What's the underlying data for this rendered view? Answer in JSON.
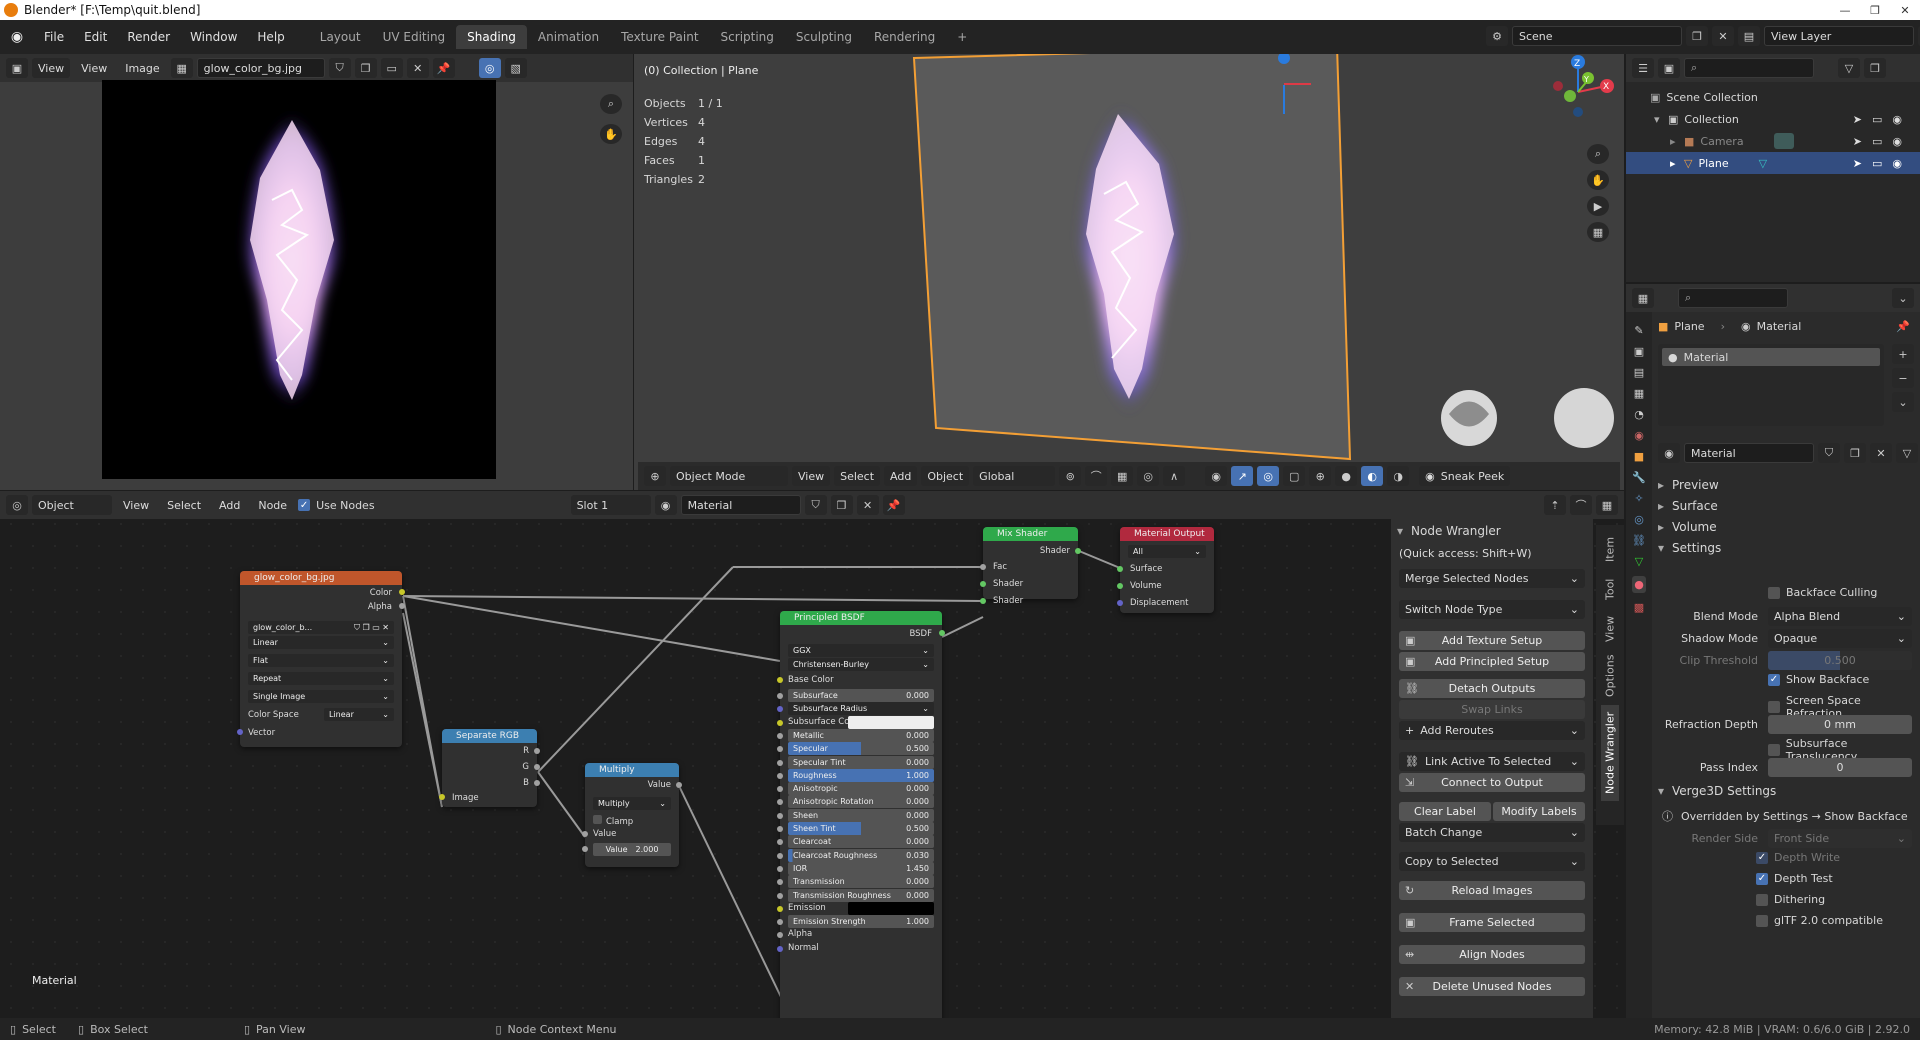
{
  "window": {
    "title": "Blender* [F:\\Temp\\quit.blend]",
    "controls": [
      "—",
      "❐",
      "✕"
    ]
  },
  "menu": [
    "File",
    "Edit",
    "Render",
    "Window",
    "Help"
  ],
  "workspaces": [
    {
      "label": "Layout",
      "active": false
    },
    {
      "label": "UV Editing",
      "active": false
    },
    {
      "label": "Shading",
      "active": true
    },
    {
      "label": "Animation",
      "active": false
    },
    {
      "label": "Texture Paint",
      "active": false
    },
    {
      "label": "Scripting",
      "active": false
    },
    {
      "label": "Sculpting",
      "active": false
    },
    {
      "label": "Rendering",
      "active": false
    }
  ],
  "workspace_add": "+",
  "scene": {
    "name": "Scene",
    "view_layer": "View Layer"
  },
  "image_editor": {
    "view_menu": "View",
    "menu": [
      "View",
      "Image"
    ],
    "image_name": "glow_color_bg.jpg"
  },
  "viewport": {
    "header_label": "(0) Collection | Plane",
    "stats": [
      {
        "k": "Objects",
        "v": "1 / 1"
      },
      {
        "k": "Vertices",
        "v": "4"
      },
      {
        "k": "Edges",
        "v": "4"
      },
      {
        "k": "Faces",
        "v": "1"
      },
      {
        "k": "Triangles",
        "v": "2"
      }
    ],
    "mode": "Object Mode",
    "menu": [
      "View",
      "Select",
      "Add",
      "Object"
    ],
    "transform": "Global",
    "sneak": "Sneak Peek",
    "gizmo": {
      "x": "X",
      "y": "Y",
      "z": "Z"
    }
  },
  "outliner": {
    "items": [
      {
        "label": "Scene Collection",
        "level": 0,
        "selected": false
      },
      {
        "label": "Collection",
        "level": 1,
        "selected": false
      },
      {
        "label": "Camera",
        "level": 2,
        "selected": false
      },
      {
        "label": "Plane",
        "level": 2,
        "selected": true
      }
    ]
  },
  "properties": {
    "breadcrumb": {
      "object": "Plane",
      "material": "Material"
    },
    "slot_name": "Material",
    "material_name": "Material",
    "panels": [
      {
        "label": "Preview",
        "open": false
      },
      {
        "label": "Surface",
        "open": false
      },
      {
        "label": "Volume",
        "open": false
      },
      {
        "label": "Settings",
        "open": true
      }
    ],
    "settings": {
      "backface_culling": {
        "label": "Backface Culling",
        "checked": false
      },
      "blend_mode": {
        "label": "Blend Mode",
        "value": "Alpha Blend"
      },
      "shadow_mode": {
        "label": "Shadow Mode",
        "value": "Opaque"
      },
      "clip_threshold": {
        "label": "Clip Threshold",
        "value": "0.500"
      },
      "show_backface": {
        "label": "Show Backface",
        "checked": true
      },
      "ssr": {
        "label": "Screen Space Refraction",
        "checked": false
      },
      "refraction_depth": {
        "label": "Refraction Depth",
        "value": "0 mm"
      },
      "sss_translucency": {
        "label": "Subsurface Translucency",
        "checked": false
      },
      "pass_index": {
        "label": "Pass Index",
        "value": "0"
      }
    },
    "verge": {
      "title": "Verge3D Settings",
      "note": "Overridden by Settings → Show Backface",
      "render_side": {
        "label": "Render Side",
        "value": "Front Side"
      },
      "depth_write": {
        "label": "Depth Write",
        "checked": true
      },
      "depth_test": {
        "label": "Depth Test",
        "checked": true
      },
      "dithering": {
        "label": "Dithering",
        "checked": false
      },
      "gltf": {
        "label": "glTF 2.0 compatible",
        "checked": false
      }
    }
  },
  "node_editor": {
    "object_mode": "Object",
    "menu": [
      "View",
      "Select",
      "Add",
      "Node"
    ],
    "use_nodes": "Use Nodes",
    "slot": "Slot 1",
    "material": "Material",
    "material_label": "Material",
    "sidebar_tabs": [
      "Item",
      "Tool",
      "View",
      "Options",
      "Node Wrangler"
    ],
    "wrangler": {
      "title": "Node Wrangler",
      "quick": "(Quick access: Shift+W)",
      "dropdowns": [
        "Merge Selected Nodes",
        "Switch Node Type"
      ],
      "buttons1": [
        "Add Texture Setup",
        "Add Principled Setup",
        "Detach Outputs",
        "Swap Links"
      ],
      "add_reroutes": "Add Reroutes",
      "link_active": "Link Active To Selected",
      "connect_output": "Connect to Output",
      "clear_label": "Clear Label",
      "modify_labels": "Modify Labels",
      "batch": "Batch Change",
      "copy": "Copy to Selected",
      "buttons2": [
        "Reload Images",
        "Frame Selected",
        "Align Nodes",
        "Delete Unused Nodes"
      ]
    }
  },
  "nodes": {
    "image": {
      "title": "glow_color_bg.jpg",
      "outputs": [
        "Color",
        "Alpha"
      ],
      "img": "glow_color_b...",
      "interp": "Linear",
      "proj": "Flat",
      "ext": "Repeat",
      "src": "Single Image",
      "cs_label": "Color Space",
      "cs": "Linear",
      "vector": "Vector"
    },
    "sep": {
      "title": "Separate RGB",
      "outputs": [
        "R",
        "G",
        "B"
      ],
      "input": "Image"
    },
    "mult": {
      "title": "Multiply",
      "output": "Value",
      "op": "Multiply",
      "clamp": "Clamp",
      "input": "Value",
      "value_label": "Value",
      "value": "2.000"
    },
    "mix": {
      "title": "Mix Shader",
      "output": "Shader",
      "inputs": [
        "Fac",
        "Shader",
        "Shader"
      ]
    },
    "out": {
      "title": "Material Output",
      "target": "All",
      "inputs": [
        "Surface",
        "Volume",
        "Displacement"
      ]
    },
    "bsdf": {
      "title": "Principled BSDF",
      "output": "BSDF",
      "dist": "GGX",
      "ssm": "Christensen-Burley",
      "base": "Base Color",
      "rows": [
        {
          "k": "Subsurface",
          "v": "0.000",
          "fill": 0
        },
        {
          "k": "Subsurface Radius",
          "v": "",
          "fill": -1
        },
        {
          "k": "Subsurface Color",
          "v": "",
          "fill": -2
        },
        {
          "k": "Metallic",
          "v": "0.000",
          "fill": 0
        },
        {
          "k": "Specular",
          "v": "0.500",
          "fill": 0.5
        },
        {
          "k": "Specular Tint",
          "v": "0.000",
          "fill": 0
        },
        {
          "k": "Roughness",
          "v": "1.000",
          "fill": 1
        },
        {
          "k": "Anisotropic",
          "v": "0.000",
          "fill": 0
        },
        {
          "k": "Anisotropic Rotation",
          "v": "0.000",
          "fill": 0
        },
        {
          "k": "Sheen",
          "v": "0.000",
          "fill": 0
        },
        {
          "k": "Sheen Tint",
          "v": "0.500",
          "fill": 0.5
        },
        {
          "k": "Clearcoat",
          "v": "0.000",
          "fill": 0
        },
        {
          "k": "Clearcoat Roughness",
          "v": "0.030",
          "fill": 0.03
        },
        {
          "k": "IOR",
          "v": "1.450",
          "fill": 0
        },
        {
          "k": "Transmission",
          "v": "0.000",
          "fill": 0
        },
        {
          "k": "Transmission Roughness",
          "v": "0.000",
          "fill": 0
        },
        {
          "k": "Emission",
          "v": "",
          "fill": -3
        },
        {
          "k": "Emission Strength",
          "v": "1.000",
          "fill": 0
        },
        {
          "k": "Alpha",
          "v": "",
          "fill": -4
        },
        {
          "k": "Normal",
          "v": "",
          "fill": -4
        }
      ]
    }
  },
  "status": {
    "select": "Select",
    "box": "Box Select",
    "pan": "Pan View",
    "ctx": "Node Context Menu",
    "mem": "Memory: 42.8 MiB | VRAM: 0.6/6.0 GiB | 2.92.0"
  }
}
